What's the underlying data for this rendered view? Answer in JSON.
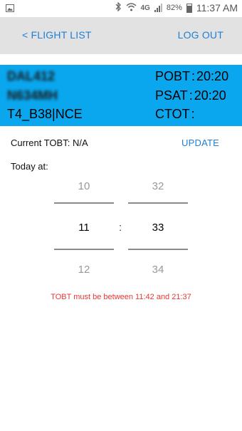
{
  "statusbar": {
    "notification_icon": "image-icon",
    "icons": [
      "bluetooth-icon",
      "wifi-icon",
      "lte-icon",
      "signal-icon"
    ],
    "network": "4G",
    "battery": "82%",
    "time": "11:37 AM"
  },
  "toolbar": {
    "back_label": "< FLIGHT LIST",
    "logout_label": "LOG OUT"
  },
  "flight": {
    "callsign": "DAL412",
    "registration": "N634MH",
    "route": "T4_B38|NCE",
    "pobt_label": "POBT",
    "pobt_value": "20:20",
    "psat_label": "PSAT",
    "psat_value": "20:20",
    "ctot_label": "CTOT",
    "ctot_value": ""
  },
  "tobt": {
    "label": "Current TOBT: N/A",
    "update_label": "UPDATE"
  },
  "today_label": "Today at:",
  "picker": {
    "hours": {
      "prev": "10",
      "current": "11",
      "next": "12"
    },
    "minutes": {
      "prev": "32",
      "current": "33",
      "next": "34"
    },
    "separator": ":"
  },
  "error_message": "TOBT must be between 11:42 and 21:37",
  "colors": {
    "accent": "#1e7fd6",
    "flight_bg": "#0aa7ef",
    "toolbar_bg": "#e2e2e2",
    "error": "#e53935"
  }
}
